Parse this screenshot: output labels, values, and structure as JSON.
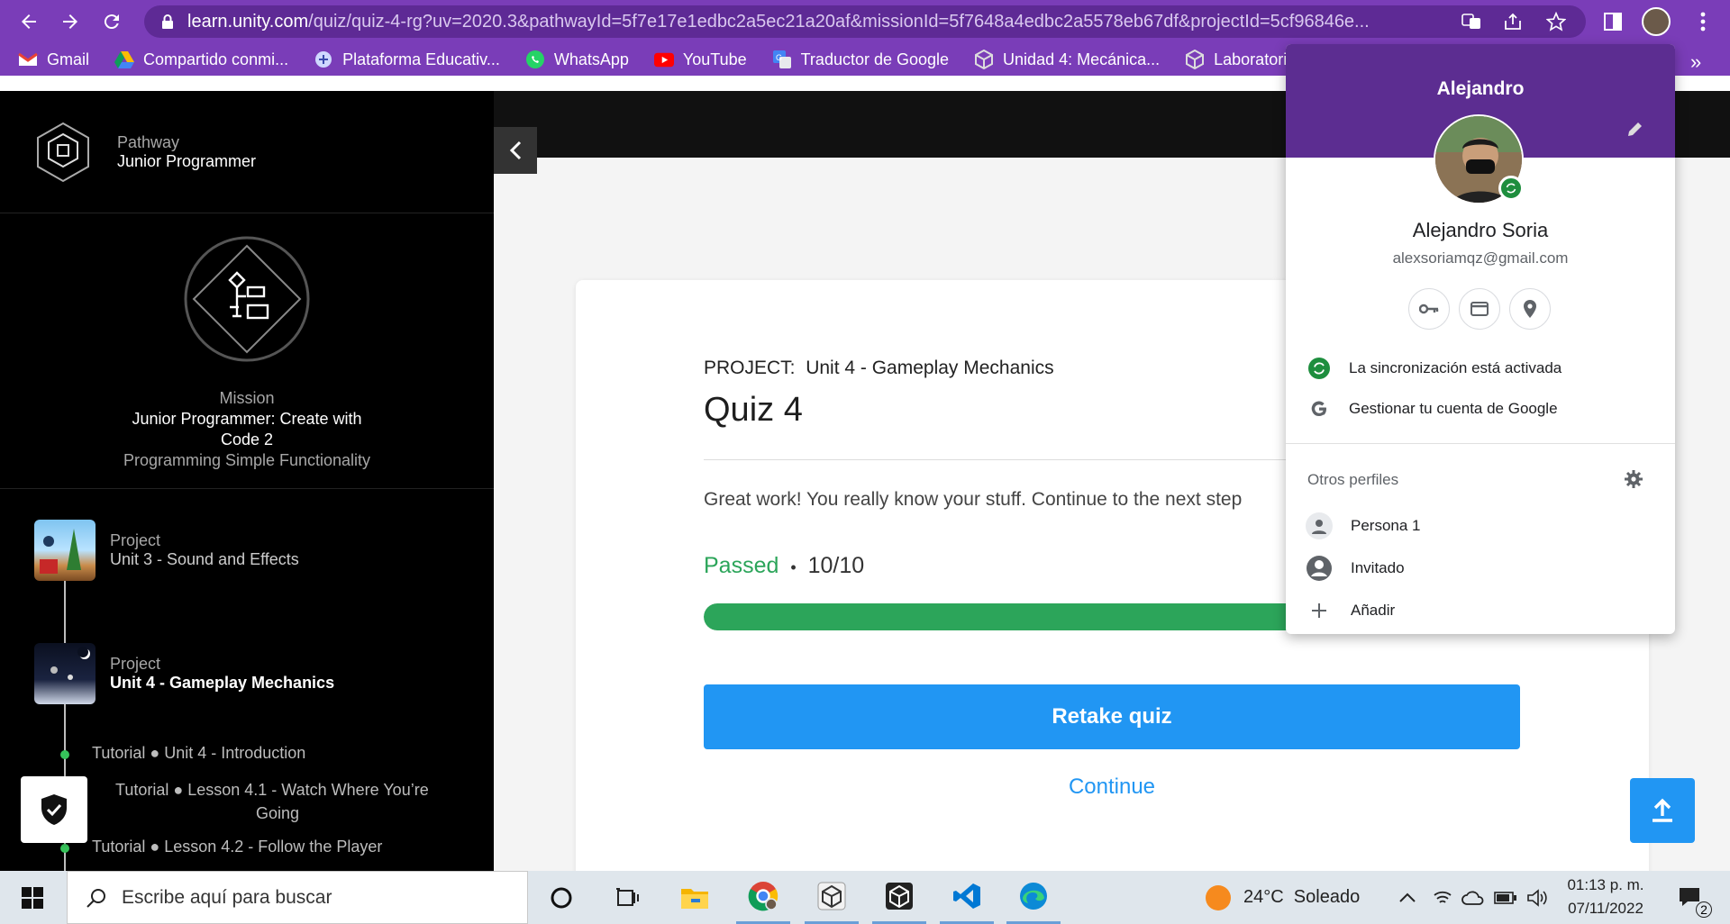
{
  "browser": {
    "url_host": "learn.unity.com",
    "url_path": "/quiz/quiz-4-rg?uv=2020.3&pathwayId=5f7e17e1edbc2a5ec21a20af&missionId=5f7648a4edbc2a5578eb67df&projectId=5cf96846e...",
    "bookmarks": [
      {
        "label": "Gmail",
        "icon": "gmail-icon"
      },
      {
        "label": "Compartido conmi...",
        "icon": "drive-icon"
      },
      {
        "label": "Plataforma Educativ...",
        "icon": "platform-icon"
      },
      {
        "label": "WhatsApp",
        "icon": "whatsapp-icon"
      },
      {
        "label": "YouTube",
        "icon": "youtube-icon"
      },
      {
        "label": "Traductor de Google",
        "icon": "translate-icon"
      },
      {
        "label": "Unidad 4: Mecánica...",
        "icon": "unity-icon"
      },
      {
        "label": "Laboratorio",
        "icon": "unity-icon"
      }
    ],
    "more_bookmarks": "»"
  },
  "sidebar": {
    "pathway_label": "Pathway",
    "pathway_name": "Junior Programmer",
    "mission_label": "Mission",
    "mission_name_1": "Junior Programmer: Create with",
    "mission_name_2": "Code 2",
    "mission_sub": "Programming Simple Functionality",
    "projects": [
      {
        "label": "Project",
        "name": "Unit 3 - Sound and Effects"
      },
      {
        "label": "Project",
        "name": "Unit 4 - Gameplay Mechanics"
      }
    ],
    "tutorials": [
      "Tutorial ● Unit 4 - Introduction",
      "Tutorial ● Lesson 4.1 - Watch Where You’re",
      "Going",
      "Tutorial ● Lesson 4.2 - Follow the Player"
    ]
  },
  "quiz": {
    "project_label": "PROJECT:",
    "project_name": "Unit 4 - Gameplay Mechanics",
    "title": "Quiz 4",
    "message": "Great work! You really know your stuff. Continue to the next step",
    "status": "Passed",
    "bullet": "•",
    "score": "10/10",
    "progress_fraction": 1.0,
    "retake_label": "Retake quiz",
    "continue_label": "Continue"
  },
  "profile_popup": {
    "header_name": "Alejandro",
    "full_name": "Alejandro Soria",
    "email": "alexsoriamqz@gmail.com",
    "sync_status": "La sincronización está activada",
    "manage_account": "Gestionar tu cuenta de Google",
    "other_profiles_label": "Otros perfiles",
    "profiles": [
      {
        "label": "Persona 1",
        "icon": "person-icon"
      },
      {
        "label": "Invitado",
        "icon": "guest-icon"
      },
      {
        "label": "Añadir",
        "icon": "plus-icon"
      }
    ]
  },
  "taskbar": {
    "search_placeholder": "Escribe aquí para buscar",
    "weather": "24°C  Soleado",
    "time": "01:13 p. m.",
    "date": "07/11/2022",
    "notification_count": "2"
  },
  "colors": {
    "chrome_purple": "#7a3db8",
    "profile_header": "#5c2d91",
    "accent_blue": "#2196f3",
    "passed_green": "#2ca55a"
  }
}
